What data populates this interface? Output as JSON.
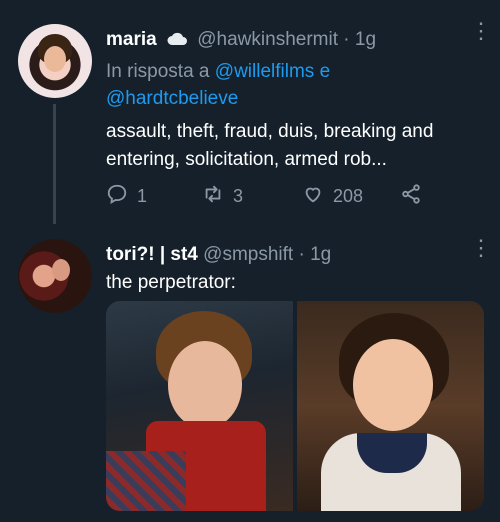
{
  "tweet1": {
    "display_name": "maria",
    "badge_icon": "cloud-icon",
    "handle": "@hawkinshermit",
    "separator": "·",
    "time": "1g",
    "reply_prefix": "In risposta a",
    "reply_user1": "@willelfilms",
    "reply_conj": "e",
    "reply_user2": "@hardtcbelieve",
    "text_line1": "assault, theft, fraud, duis, breaking and",
    "text_line2": "entering, solicitation, armed rob...",
    "replies": "1",
    "retweets": "3",
    "likes": "208"
  },
  "tweet2": {
    "display_name": "tori?! | st4",
    "handle": "@smpshift",
    "separator": "·",
    "time": "1g",
    "text": "the perpetrator:"
  },
  "colors": {
    "background": "#15202b",
    "text": "#ffffff",
    "muted": "#8b98a5",
    "link": "#1d9bf0",
    "thread_line": "#38444d"
  }
}
